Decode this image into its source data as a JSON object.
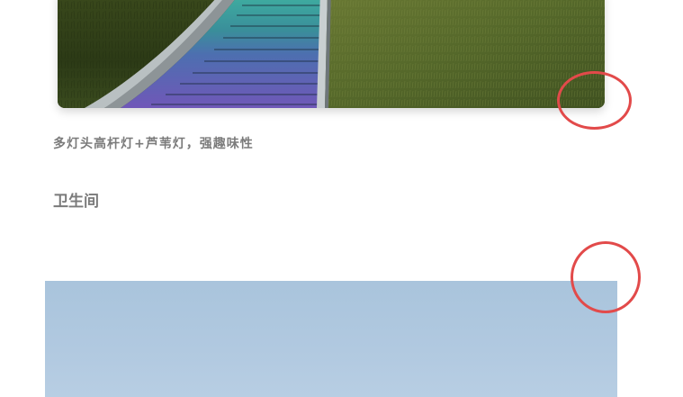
{
  "article": {
    "photo_caption": "多灯头高杆灯+芦苇灯，强趣味性",
    "next_section_heading": "卫生间"
  },
  "images": {
    "top_photo": "slide-on-grass-photo",
    "bottom_photo": "sky-photo"
  },
  "annotations": {
    "color": "#e24a4a",
    "count": 2
  },
  "colors": {
    "caption_text": "#7b7b7b",
    "heading_text": "#7a7a7a",
    "sky": "#b1c9e0",
    "grass": "#4a5a26"
  }
}
